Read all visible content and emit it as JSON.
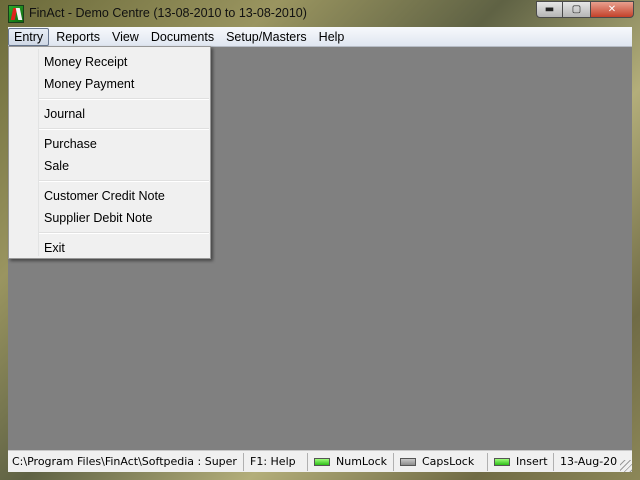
{
  "window": {
    "title": "FinAct - Demo Centre (13-08-2010 to 13-08-2010)",
    "minimize_glyph": "▬",
    "maximize_glyph": "▢",
    "close_glyph": "✕",
    "icon": "finact-app-icon"
  },
  "menubar": {
    "items": [
      {
        "label": "Entry",
        "active": true
      },
      {
        "label": "Reports"
      },
      {
        "label": "View"
      },
      {
        "label": "Documents"
      },
      {
        "label": "Setup/Masters"
      },
      {
        "label": "Help"
      }
    ]
  },
  "entry_menu": {
    "items": [
      {
        "label": "Money Receipt"
      },
      {
        "label": "Money Payment"
      },
      {
        "label": "Journal"
      },
      {
        "label": "Purchase"
      },
      {
        "label": "Sale"
      },
      {
        "label": "Customer Credit Note"
      },
      {
        "label": "Supplier Debit Note"
      },
      {
        "label": "Exit"
      }
    ]
  },
  "statusbar": {
    "path": "C:\\Program Files\\FinAct\\Softpedia : Super",
    "help": "F1: Help",
    "numlock": {
      "label": "NumLock",
      "on": true
    },
    "capslock": {
      "label": "CapsLock",
      "on": false
    },
    "insert": {
      "label": "Insert",
      "on": true
    },
    "date": "13-Aug-20"
  },
  "colors": {
    "client_bg": "#808080",
    "menu_bg": "#f0f0f0",
    "led_on": "#2fbe1a",
    "led_off": "#8c8c8c"
  }
}
